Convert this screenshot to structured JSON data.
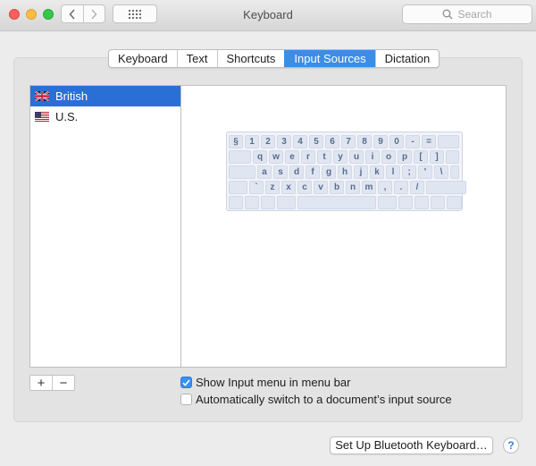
{
  "window": {
    "title": "Keyboard"
  },
  "search": {
    "placeholder": "Search"
  },
  "tabs": [
    {
      "label": "Keyboard",
      "active": false
    },
    {
      "label": "Text",
      "active": false
    },
    {
      "label": "Shortcuts",
      "active": false
    },
    {
      "label": "Input Sources",
      "active": true
    },
    {
      "label": "Dictation",
      "active": false
    }
  ],
  "sources": [
    {
      "label": "British",
      "flag": "uk-flag-icon",
      "selected": true
    },
    {
      "label": "U.S.",
      "flag": "us-flag-icon",
      "selected": false
    }
  ],
  "keyboard_rows": [
    [
      "§",
      "1",
      "2",
      "3",
      "4",
      "5",
      "6",
      "7",
      "8",
      "9",
      "0",
      "-",
      "="
    ],
    [
      "q",
      "w",
      "e",
      "r",
      "t",
      "y",
      "u",
      "i",
      "o",
      "p",
      "[",
      "]"
    ],
    [
      "a",
      "s",
      "d",
      "f",
      "g",
      "h",
      "j",
      "k",
      "l",
      ";",
      "'",
      "\\"
    ],
    [
      "`",
      "z",
      "x",
      "c",
      "v",
      "b",
      "n",
      "m",
      ",",
      ".",
      "/"
    ]
  ],
  "list_controls": {
    "add": "+",
    "remove": "−"
  },
  "options": {
    "show_input_menu": {
      "label": "Show Input menu in menu bar",
      "checked": true
    },
    "auto_switch": {
      "label": "Automatically switch to a document’s input source",
      "checked": false
    }
  },
  "footer": {
    "bluetooth_button": "Set Up Bluetooth Keyboard…",
    "help": "?"
  },
  "colors": {
    "accent": "#3c8de4",
    "selection": "#2a6fd6"
  }
}
